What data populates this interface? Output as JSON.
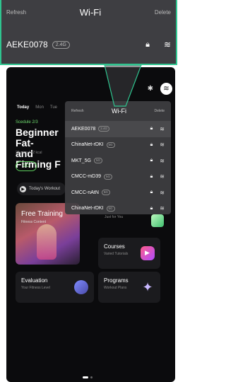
{
  "callout": {
    "refresh": "Refresh",
    "title": "Wi-Fi",
    "delete": "Delete",
    "selected_network": {
      "name": "AEKE0078",
      "band": "2.4G"
    }
  },
  "app": {
    "tabs": [
      "Today",
      "Mon",
      "Tue"
    ],
    "schedule": "Scedule 2/3",
    "title": "Beginner Fat-\nand Firming F",
    "meta": "28 mins  |  42 kcal",
    "go": "GO",
    "workouts_label": "Today's Workout",
    "cards": {
      "free_training": {
        "title": "Free Training",
        "subtitle": "Fitness Content"
      },
      "just_for_you": {
        "subtitle": "Just for You"
      },
      "courses": {
        "title": "Courses",
        "subtitle": "Varied Tutorials"
      },
      "evaluation": {
        "title": "Evaluation",
        "subtitle": "Your Fitness Level"
      },
      "programs": {
        "title": "Programs",
        "subtitle": "Workout Plans"
      }
    }
  },
  "wifi_dropdown": {
    "refresh": "Refresh",
    "title": "Wi-Fi",
    "delete": "Delete",
    "networks": [
      {
        "name": "AEKE0078",
        "band": "2.4G"
      },
      {
        "name": "ChinaNet-rDKI",
        "band": "5G"
      },
      {
        "name": "MKT_5G",
        "band": "5G"
      },
      {
        "name": "CMCC-mD39",
        "band": "5G"
      },
      {
        "name": "CMCC-nAtN",
        "band": "5G"
      },
      {
        "name": "ChinaNet-rDKI",
        "band": "5G"
      }
    ]
  },
  "colors": {
    "accent": "#2fc48f",
    "schedule_green": "#6fdc6f",
    "background": "#0b0b0d"
  },
  "icons": [
    "bluetooth-icon",
    "wifi-icon",
    "lock-icon",
    "play-icon",
    "star-icon",
    "trend-icon"
  ]
}
